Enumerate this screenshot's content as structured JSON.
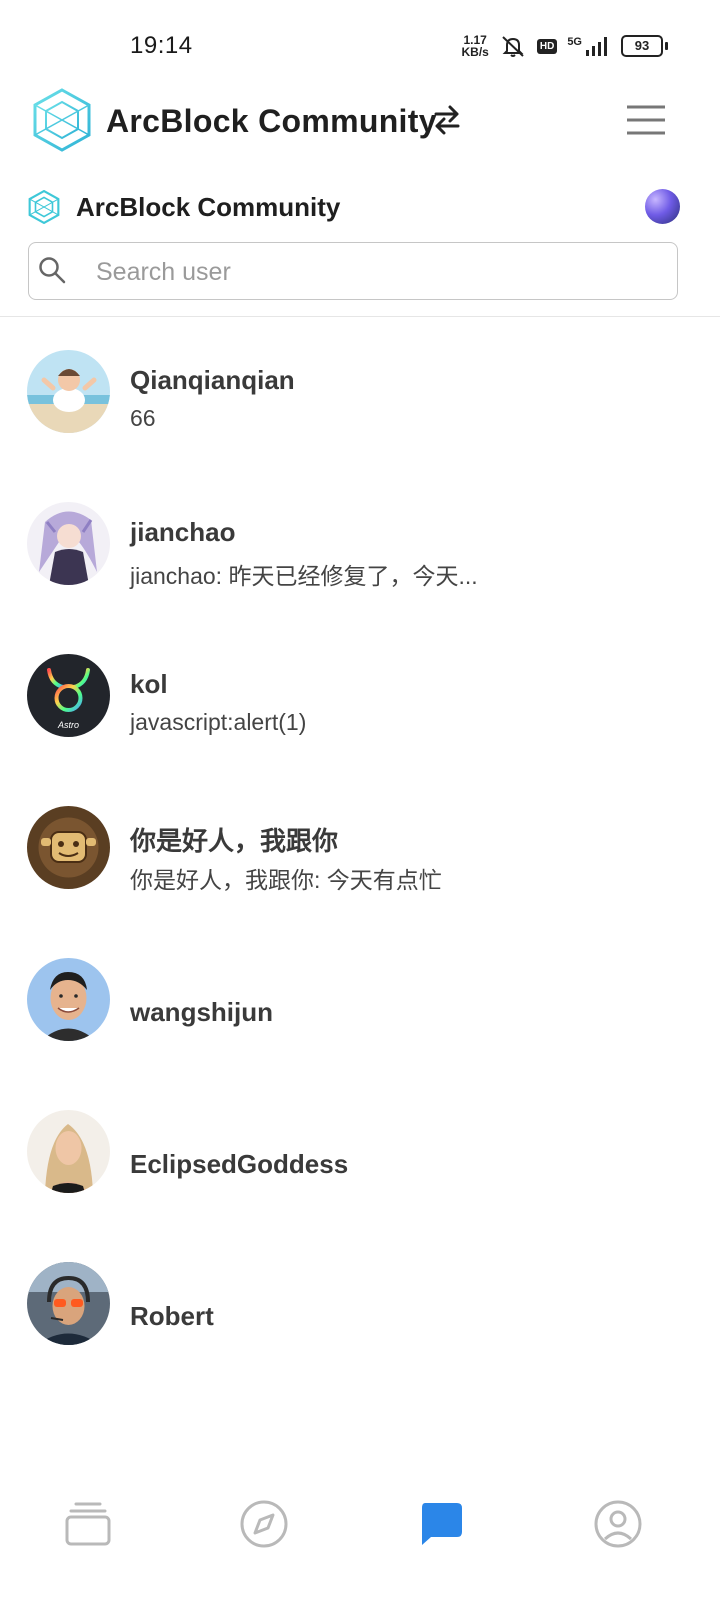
{
  "status_bar": {
    "time": "19:14",
    "net_speed_value": "1.17",
    "net_speed_unit": "KB/s",
    "hd_label": "HD",
    "network_label": "5G",
    "battery": "93"
  },
  "app_bar": {
    "title": "ArcBlock Community"
  },
  "community": {
    "name": "ArcBlock Community"
  },
  "search": {
    "placeholder": "Search user",
    "value": ""
  },
  "chats": [
    {
      "name": "Qianqianqian",
      "preview": "66"
    },
    {
      "name": "jianchao",
      "preview": "jianchao: 昨天已经修复了，今天..."
    },
    {
      "name": "kol",
      "preview": "javascript:alert(1)",
      "avatar_text": "Astro"
    },
    {
      "name": "你是好人，我跟你",
      "preview": "你是好人，我跟你: 今天有点忙"
    },
    {
      "name": "wangshijun",
      "preview": ""
    },
    {
      "name": "EclipsedGoddess",
      "preview": ""
    },
    {
      "name": "Robert",
      "preview": ""
    }
  ],
  "bottom_nav": [
    {
      "icon": "cards-icon",
      "active": false
    },
    {
      "icon": "compass-icon",
      "active": false
    },
    {
      "icon": "chat-icon",
      "active": true
    },
    {
      "icon": "profile-icon",
      "active": false
    }
  ],
  "colors": {
    "logo": "#3ec8d8",
    "active_nav": "#2b86e8",
    "inactive_nav": "#b9b9b9",
    "text_primary": "#1f1f1f"
  }
}
